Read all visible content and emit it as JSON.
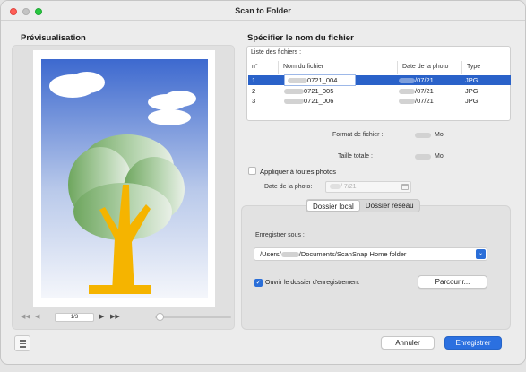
{
  "window": {
    "title": "Scan to Folder"
  },
  "preview": {
    "title": "Prévisualisation",
    "page_indicator": "1/3"
  },
  "file_spec": {
    "title": "Spécifier le nom du fichier",
    "list_label": "Liste des fichiers :",
    "columns": [
      "n°",
      "Nom du fichier",
      "Date de la photo",
      "Type"
    ],
    "rows": [
      {
        "n": "1",
        "name": "0721_004",
        "date": "/07/21",
        "type": "JPG",
        "selected": true
      },
      {
        "n": "2",
        "name": "0721_005",
        "date": "/07/21",
        "type": "JPG",
        "selected": false
      },
      {
        "n": "3",
        "name": "0721_006",
        "date": "/07/21",
        "type": "JPG",
        "selected": false
      }
    ],
    "file_format_label": "Format de fichier :",
    "file_format_unit": "Mo",
    "total_size_label": "Taille totale :",
    "total_size_unit": "Mo",
    "apply_all_label": "Appliquer à toutes photos",
    "photo_date_label": "Date de la photo:",
    "photo_date_value": "/  7/21"
  },
  "save": {
    "tabs": [
      "Dossier local",
      "Dossier réseau"
    ],
    "active_tab": "Dossier local",
    "save_under_label": "Enregistrer sous :",
    "path_prefix": "/Users/",
    "path_suffix": "/Documents/ScanSnap Home folder",
    "open_folder_label": "Ouvrir le dossier d'enregistrement",
    "open_folder_checked": true,
    "browse_label": "Parcourir..."
  },
  "footer": {
    "cancel_label": "Annuler",
    "save_label": "Enregistrer"
  },
  "colors": {
    "accent": "#2b70e0",
    "selection": "#2a62c9",
    "close": "#ff5f57",
    "zoom": "#28c840"
  }
}
